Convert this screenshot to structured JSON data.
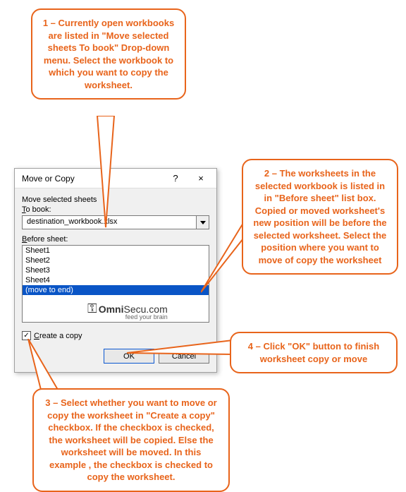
{
  "callouts": {
    "c1": "1 – Currently open workbooks are listed in \"Move selected sheets To book\" Drop-down menu. Select the workbook to which you want to copy the worksheet.",
    "c2": "2 – The worksheets in the selected workbook is listed in in \"Before sheet\" list box. Copied or moved worksheet's new position will be before the selected worksheet. Select the position where you want to move of copy the worksheet",
    "c3": "3 – Select whether you want to move or copy the worksheet in \"Create a copy\" checkbox. If the checkbox is checked, the worksheet will be copied. Else the worksheet will be moved. In this example , the checkbox is checked to  copy the worksheet.",
    "c4": "4 – Click \"OK\" button to finish worksheet copy or move"
  },
  "dialog": {
    "title": "Move or Copy",
    "help": "?",
    "close": "×",
    "section1": "Move selected sheets",
    "tobook_label": "To book:",
    "tobook_value": "destination_workbook.xlsx",
    "before_label": "Before sheet:",
    "sheets": [
      "Sheet1",
      "Sheet2",
      "Sheet3",
      "Sheet4",
      "(move to end)"
    ],
    "create_copy": "Create a copy",
    "checked": "✓",
    "ok": "OK",
    "cancel": "Cancel"
  },
  "watermark": {
    "brand": "OmniSecu.com",
    "tag": "feed your brain"
  }
}
